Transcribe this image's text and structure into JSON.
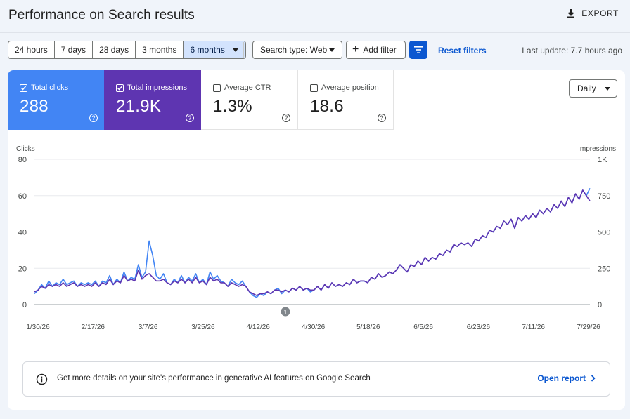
{
  "header": {
    "title": "Performance on Search results",
    "export_label": "EXPORT"
  },
  "filters": {
    "ranges": [
      "24 hours",
      "7 days",
      "28 days",
      "3 months",
      "6 months"
    ],
    "active_range": "6 months",
    "search_type": "Search type: Web",
    "add_filter": "Add filter",
    "reset": "Reset filters",
    "last_update": "Last update: 7.7 hours ago"
  },
  "metrics": {
    "clicks": {
      "label": "Total clicks",
      "value": "288",
      "checked": true
    },
    "impressions": {
      "label": "Total impressions",
      "value": "21.9K",
      "checked": true
    },
    "ctr": {
      "label": "Average CTR",
      "value": "1.3%",
      "checked": false
    },
    "position": {
      "label": "Average position",
      "value": "18.6",
      "checked": false
    }
  },
  "granularity": "Daily",
  "colors": {
    "clicks": "#4285f4",
    "impressions": "#5e35b1",
    "accent": "#0b57d0"
  },
  "chart_data": {
    "type": "line",
    "left_axis_label": "Clicks",
    "right_axis_label": "Impressions",
    "left_ticks": [
      "80",
      "60",
      "40",
      "20",
      "0"
    ],
    "right_ticks": [
      "1K",
      "750",
      "500",
      "250",
      "0"
    ],
    "ylim_left": [
      0,
      80
    ],
    "ylim_right": [
      0,
      1000
    ],
    "x_ticks": [
      "1/30/26",
      "2/17/26",
      "3/7/26",
      "3/25/26",
      "4/12/26",
      "4/30/26",
      "5/18/26",
      "6/5/26",
      "6/23/26",
      "7/11/26",
      "7/29/26"
    ],
    "annotation": "1",
    "annotation_date": "4/18/26",
    "series": [
      {
        "name": "Total clicks",
        "axis": "left",
        "values": [
          6,
          8,
          11,
          9,
          13,
          10,
          12,
          11,
          14,
          11,
          12,
          13,
          10,
          12,
          11,
          12,
          11,
          13,
          10,
          13,
          12,
          16,
          11,
          14,
          12,
          18,
          13,
          15,
          14,
          22,
          15,
          18,
          35,
          27,
          16,
          14,
          17,
          12,
          11,
          14,
          12,
          16,
          12,
          15,
          13,
          17,
          12,
          14,
          11,
          18,
          14,
          16,
          13,
          12,
          10,
          14,
          12,
          11,
          13,
          10,
          7,
          5,
          4,
          6,
          5,
          7,
          6,
          8,
          9,
          6,
          8,
          7,
          9,
          8,
          10,
          8,
          9,
          7,
          8,
          10,
          8,
          11,
          9,
          12,
          10,
          11,
          10,
          12,
          11,
          14,
          12,
          13,
          13,
          12,
          15,
          14,
          17,
          15,
          16,
          18,
          17,
          19,
          22,
          20,
          18,
          22,
          21,
          24,
          22,
          26,
          24,
          26,
          25,
          28,
          27,
          30,
          29,
          33,
          32,
          34,
          33,
          34,
          32,
          36,
          35,
          38,
          37,
          41,
          40,
          43,
          42,
          46,
          44,
          47,
          42,
          48,
          46,
          49,
          47,
          50,
          48,
          52,
          50,
          53,
          51,
          55,
          53,
          57,
          54,
          59,
          56,
          61,
          58,
          63,
          60,
          64
        ]
      },
      {
        "name": "Total impressions",
        "axis": "right",
        "values": [
          88,
          100,
          125,
          112,
          138,
          125,
          138,
          125,
          150,
          125,
          138,
          150,
          125,
          138,
          125,
          138,
          125,
          150,
          125,
          150,
          138,
          175,
          138,
          163,
          150,
          200,
          163,
          175,
          163,
          238,
          175,
          200,
          213,
          188,
          163,
          163,
          175,
          150,
          138,
          163,
          150,
          175,
          150,
          175,
          150,
          188,
          150,
          163,
          138,
          188,
          163,
          175,
          150,
          150,
          125,
          150,
          138,
          125,
          138,
          125,
          88,
          75,
          63,
          75,
          75,
          88,
          75,
          100,
          100,
          88,
          100,
          88,
          113,
          100,
          125,
          100,
          113,
          100,
          100,
          125,
          100,
          138,
          113,
          150,
          125,
          138,
          125,
          150,
          138,
          175,
          150,
          163,
          163,
          150,
          188,
          175,
          213,
          188,
          200,
          225,
          213,
          238,
          275,
          250,
          225,
          275,
          263,
          300,
          275,
          325,
          300,
          325,
          313,
          350,
          338,
          375,
          363,
          413,
          400,
          425,
          413,
          425,
          400,
          450,
          438,
          475,
          463,
          513,
          500,
          538,
          525,
          575,
          550,
          588,
          525,
          600,
          575,
          613,
          588,
          625,
          600,
          650,
          625,
          663,
          638,
          688,
          663,
          713,
          675,
          738,
          700,
          763,
          725,
          788,
          750,
          713
        ]
      }
    ]
  },
  "ai_banner": {
    "text": "Get more details on your site's performance in generative AI features on Google Search",
    "link": "Open report"
  }
}
